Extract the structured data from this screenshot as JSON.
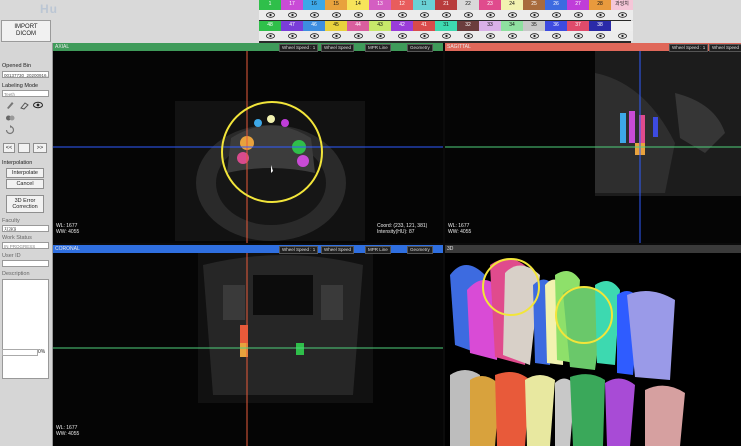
{
  "toolbar": {
    "import_dicom_label": "IMPORT\nDICOM",
    "logo_text": "Hu"
  },
  "tooth_palette": {
    "row1": [
      {
        "label": "1\n18",
        "color": "#2fbf4a",
        "dark": true
      },
      {
        "label": "17",
        "color": "#c94bd6",
        "dark": true
      },
      {
        "label": "16",
        "color": "#3da8e8",
        "dark": false
      },
      {
        "label": "15",
        "color": "#e8a23d",
        "dark": false
      },
      {
        "label": "14",
        "color": "#f7e45a",
        "dark": false
      },
      {
        "label": "13",
        "color": "#d45ec2",
        "dark": true
      },
      {
        "label": "12",
        "color": "#e85d5d",
        "dark": true
      },
      {
        "label": "11",
        "color": "#6ad1d6",
        "dark": false
      },
      {
        "label": "21",
        "color": "#b83d3d",
        "dark": true
      },
      {
        "label": "22",
        "color": "#d9d9d9",
        "dark": false
      },
      {
        "label": "23",
        "color": "#e04b8d",
        "dark": true
      },
      {
        "label": "24",
        "color": "#f2f2b0",
        "dark": false
      },
      {
        "label": "25",
        "color": "#a86b3d",
        "dark": true
      },
      {
        "label": "26",
        "color": "#3d6be0",
        "dark": true
      },
      {
        "label": "27",
        "color": "#c03dd9",
        "dark": true
      },
      {
        "label": "28",
        "color": "#e89a3d",
        "dark": false
      },
      {
        "label": "과잉치",
        "color": "#f5c6d8",
        "dark": false
      }
    ],
    "row2": [
      {
        "label": "48",
        "color": "#2fbf4a",
        "dark": true
      },
      {
        "label": "47",
        "color": "#7a3dd9",
        "dark": true
      },
      {
        "label": "46",
        "color": "#3d8ee0",
        "dark": true
      },
      {
        "label": "45",
        "color": "#e8d23d",
        "dark": false
      },
      {
        "label": "44",
        "color": "#d95e9e",
        "dark": true
      },
      {
        "label": "43",
        "color": "#c8e86a",
        "dark": false
      },
      {
        "label": "42",
        "color": "#9a3dd9",
        "dark": true
      },
      {
        "label": "41",
        "color": "#d94b4b",
        "dark": true
      },
      {
        "label": "31",
        "color": "#3dd9b0",
        "dark": false
      },
      {
        "label": "32",
        "color": "#6b3d3d",
        "dark": true
      },
      {
        "label": "33",
        "color": "#d9b0e8",
        "dark": false
      },
      {
        "label": "34",
        "color": "#8ee0a0",
        "dark": false
      },
      {
        "label": "35",
        "color": "#c8c8c8",
        "dark": false
      },
      {
        "label": "36",
        "color": "#3d4be0",
        "dark": true
      },
      {
        "label": "37",
        "color": "#e04b6b",
        "dark": true
      },
      {
        "label": "38",
        "color": "#2a2aa8",
        "dark": true
      },
      {
        "label": "",
        "color": "#eeeeee",
        "dark": false
      }
    ]
  },
  "left_panel": {
    "opened_bin_label": "Opened Bin",
    "opened_bin_value": "00137730_20200916.b",
    "labeling_mode_label": "Labeling Mode",
    "labeling_mode_value": "Teeth",
    "nav_prev_label": "<<",
    "nav_next_label": ">>",
    "interpolation_label": "Interpolation",
    "interpolate_button": "Interpolate",
    "cancel_button": "Cancel",
    "error_correction_button": "3D Error\nCorrection",
    "faculty_label": "Faculty",
    "faculty_value": "치과대",
    "work_status_label": "Work Status",
    "work_status_value": "IN PROGRESS",
    "user_id_label": "User ID",
    "user_id_value": "",
    "description_label": "Description",
    "progress_pct": "0%",
    "progress_value": 0
  },
  "viewports": {
    "axial": {
      "title": "AXIAL",
      "wheel_speed_1": "Wheel Speed : 1",
      "wheel_speed_dd": "Wheel Speed",
      "mpr_line": "MPR Line",
      "geometry": "Geometry",
      "wl": "WL: 1677",
      "ww": "WW: 4055",
      "coord": "Coord: (233, 121, 381)",
      "intensity": "Intensity(HU): 87"
    },
    "sagittal": {
      "title": "SAGITTAL",
      "wheel_speed_1": "Wheel Speed : 1",
      "wheel_speed_dd": "Wheel Speed",
      "wl": "WL: 1677",
      "ww": "WW: 4055"
    },
    "coronal": {
      "title": "CORONAL",
      "wheel_speed_1": "Wheel Speed : 1",
      "wheel_speed_dd": "Wheel Speed",
      "mpr_line": "MPR Line",
      "geometry": "Geometry",
      "wl": "WL: 1677",
      "ww": "WW: 4055"
    },
    "render3d": {
      "title": "3D"
    }
  },
  "colors": {
    "axial_header": "#3f9b5a",
    "sagittal_header": "#e0685a",
    "coronal_header": "#2f6fe0",
    "crosshair_red": "#e85a3a",
    "crosshair_blue": "#2f5cff",
    "crosshair_green": "#4fd07a",
    "highlight_circle": "#f2e53a"
  }
}
